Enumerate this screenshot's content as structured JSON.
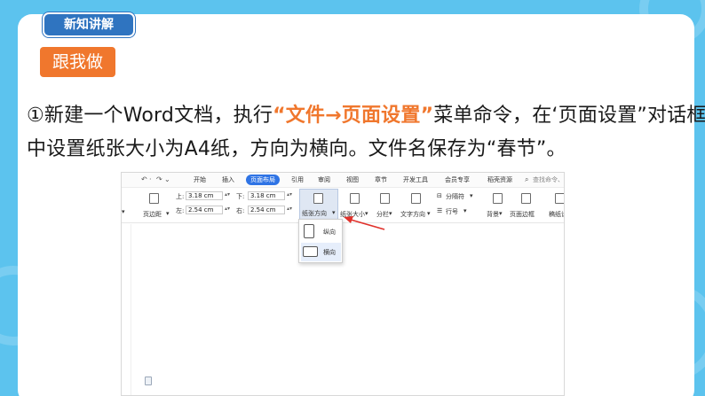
{
  "header": {
    "tab_label": "新知讲解"
  },
  "subhead": {
    "label": "跟我做"
  },
  "instruction": {
    "part1": "①新建一个Word文档，执行",
    "highlight": "“文件→页面设置”",
    "part2": "菜单命令，在‘页面设置”对话框中设置纸张大小为A4纸，方向为横向。文件名保存为“春节”。"
  },
  "screenshot": {
    "menubar": {
      "tabs": [
        "开始",
        "插入",
        "页面布局",
        "引用",
        "审阅",
        "视图",
        "章节",
        "开发工具",
        "会员专享",
        "稻壳资源"
      ],
      "active_tab": "页面布局",
      "search_placeholder": "查找命令、"
    },
    "ribbon": {
      "margins_label": "页边距",
      "top_label": "上:",
      "top_value": "3.18 cm",
      "bottom_label": "下:",
      "bottom_value": "3.18 cm",
      "left_label": "左:",
      "left_value": "2.54 cm",
      "right_label": "右:",
      "right_value": "2.54 cm",
      "orientation_label": "纸张方向",
      "size_label": "纸张大小",
      "columns_label": "分栏",
      "text_direction_label": "文字方向",
      "page_break_label": "分隔符",
      "line_number_label": "行号",
      "background_label": "背景",
      "page_border_label": "页面边框",
      "draft_label": "稿纸设"
    },
    "orientation_menu": {
      "items": [
        "纵向",
        "横向"
      ]
    }
  },
  "colors": {
    "background": "#5cc3ee",
    "header_tab": "#2f74c0",
    "accent_orange": "#f0772d",
    "active_menu": "#2f74e5",
    "arrow_red": "#e0312b"
  }
}
